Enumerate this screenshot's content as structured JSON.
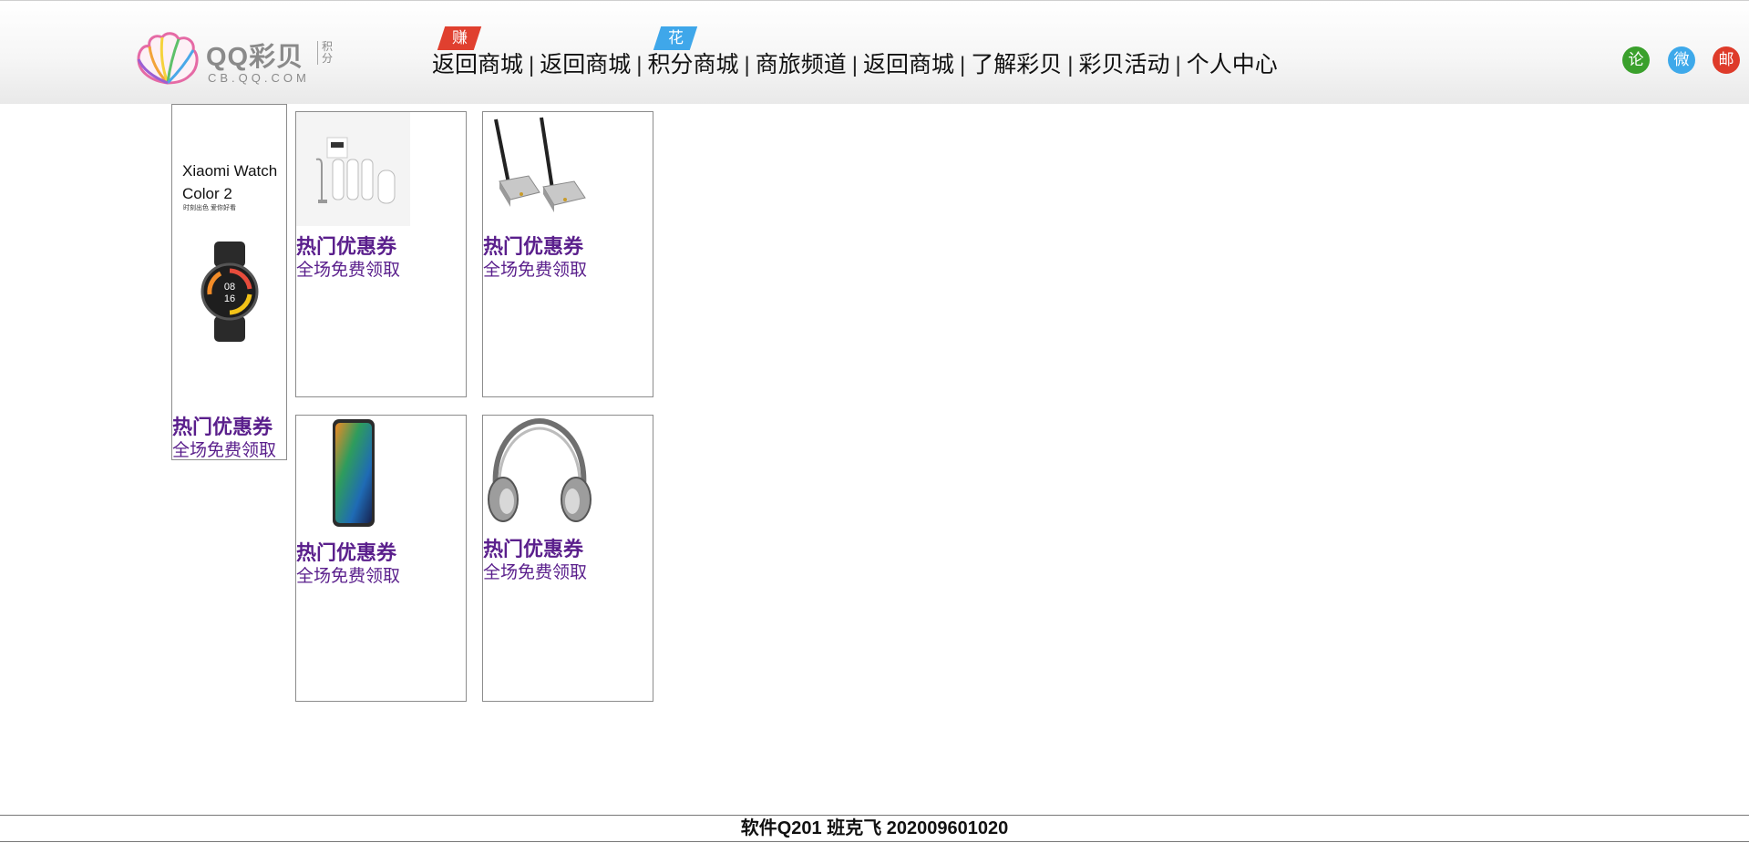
{
  "header": {
    "logo_title": "QQ彩贝",
    "logo_jifen": "积分",
    "logo_sub": "CB.QQ.COM",
    "nav": [
      {
        "label": "返回商城",
        "badge": "赚"
      },
      {
        "label": "返回商城",
        "badge": ""
      },
      {
        "label": "积分商城",
        "badge": "花"
      },
      {
        "label": "商旅频道",
        "badge": ""
      },
      {
        "label": "返回商城",
        "badge": ""
      },
      {
        "label": "了解彩贝",
        "badge": ""
      },
      {
        "label": "彩贝活动",
        "badge": ""
      },
      {
        "label": "个人中心",
        "badge": ""
      }
    ],
    "separator": "|",
    "social": [
      {
        "label": "论",
        "icon": "forum-icon",
        "color": "#3aa02c"
      },
      {
        "label": "微",
        "icon": "weibo-icon",
        "color": "#3ea9ea"
      },
      {
        "label": "邮",
        "icon": "mail-icon",
        "color": "#de3b2a"
      }
    ]
  },
  "products": [
    {
      "image_text_line1": "Xiaomi Watch",
      "image_text_line2": "Color 2",
      "image_text_tagline": "时刻出色  爱你好看",
      "watch_time_1": "08",
      "watch_time_2": "16",
      "title": "热门优惠券",
      "subtitle": "全场免费领取",
      "image": "smartwatch"
    },
    {
      "title": "热门优惠券",
      "subtitle": "全场免费领取",
      "image": "water-purifier"
    },
    {
      "title": "热门优惠券",
      "subtitle": "全场免费领取",
      "image": "wireless-transmitter"
    },
    {
      "title": "热门优惠券",
      "subtitle": "全场免费领取",
      "image": "smartphone"
    },
    {
      "title": "热门优惠券",
      "subtitle": "全场免费领取",
      "image": "headphones"
    }
  ],
  "footer": {
    "text": "软件Q201 班克飞 202009601020"
  }
}
